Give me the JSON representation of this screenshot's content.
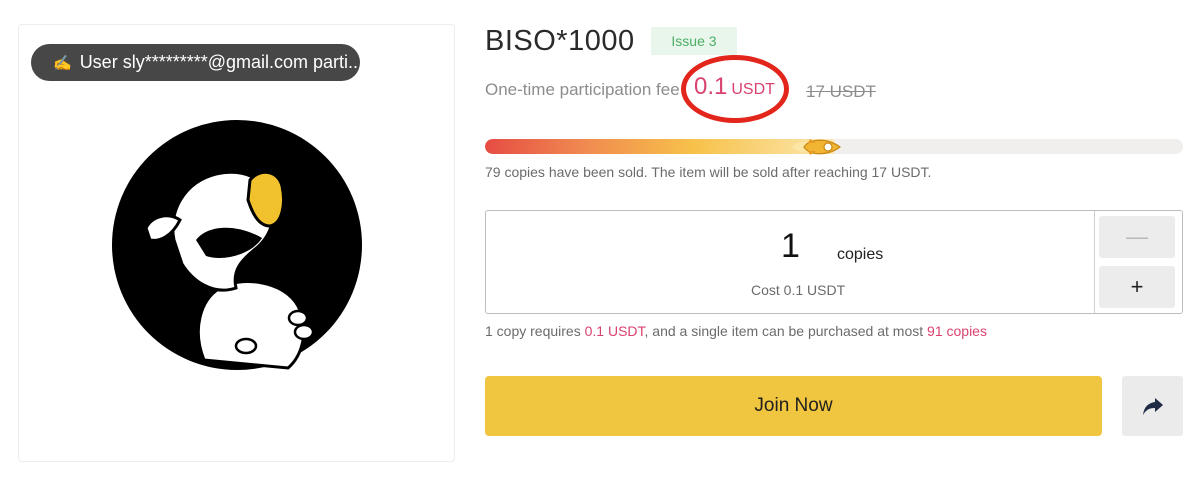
{
  "ticker": {
    "icon": "hand-writing-icon",
    "text": "User sly*********@gmail.com parti..."
  },
  "product": {
    "title": "BISO*1000",
    "issue": "Issue 3"
  },
  "fee": {
    "label": "One-time participation fee",
    "price": "0.1",
    "unit": "USDT",
    "original": "17 USDT"
  },
  "progress": {
    "fraction": 0.5,
    "status": "79 copies have been sold. The item will be sold after reaching 17 USDT."
  },
  "quantity": {
    "value": "1",
    "unit": "copies",
    "cost": "Cost 0.1 USDT",
    "minus": "—",
    "plus": "+"
  },
  "limit": {
    "prefix": "1 copy requires ",
    "price": "0.1 USDT",
    "middle": ", and a single item can be purchased at most ",
    "max": "91 copies"
  },
  "actions": {
    "join": "Join Now",
    "share_icon": "share-arrow-icon"
  },
  "colors": {
    "accent": "#f0c53f",
    "price": "#d9426e",
    "ring": "#e3261c",
    "issue_bg": "#e8f6ec",
    "issue_text": "#4cae63"
  }
}
